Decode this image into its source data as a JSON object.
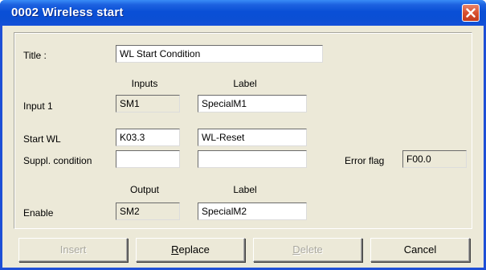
{
  "window": {
    "title": "0002  Wireless start",
    "close_icon": "close-icon"
  },
  "title_row": {
    "label": "Title :",
    "value": "WL Start Condition"
  },
  "inputs_section": {
    "col_inputs": "Inputs",
    "col_label": "Label",
    "input1": {
      "label": "Input 1",
      "input": "SM1",
      "name": "SpecialM1"
    }
  },
  "start_section": {
    "start_wl": {
      "label": "Start WL",
      "input": "K03.3",
      "name": "WL-Reset"
    },
    "suppl": {
      "label": "Suppl. condition",
      "input": "",
      "name": ""
    },
    "error_flag": {
      "label": "Error flag",
      "value": "F00.0"
    }
  },
  "output_section": {
    "col_output": "Output",
    "col_label": "Label",
    "enable": {
      "label": "Enable",
      "output": "SM2",
      "name": "SpecialM2"
    }
  },
  "buttons": {
    "insert": "Insert",
    "replace_prefix": "",
    "replace_mnemonic": "R",
    "replace_rest": "eplace",
    "delete_prefix": "",
    "delete_mnemonic": "D",
    "delete_rest": "elete",
    "cancel": "Cancel"
  },
  "colors": {
    "titlebar": "#0a4fd6",
    "dialog_bg": "#ece9d8",
    "close_button": "#d8502f"
  }
}
